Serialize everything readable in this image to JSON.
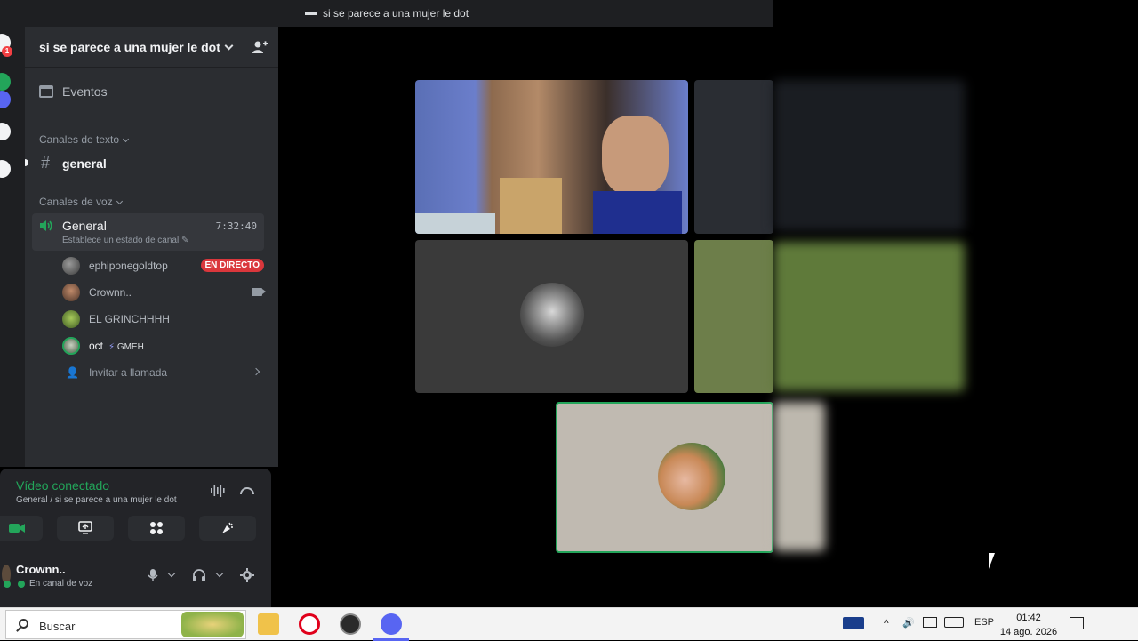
{
  "window": {
    "title": "si se parece a una mujer le dot"
  },
  "server_rail": {
    "badge": "1"
  },
  "sidebar": {
    "guild_name": "si se parece a una mujer le dot",
    "events_label": "Eventos",
    "text_category": "Canales de texto",
    "text_channel": "general",
    "voice_category": "Canales de voz",
    "voice_channel": {
      "name": "General",
      "elapsed": "7:32:40",
      "status_prompt": "Establece un estado de canal"
    },
    "members": [
      {
        "name": "ephiponegoldtop",
        "badge": "EN DIRECTO"
      },
      {
        "name": "Crownn.."
      },
      {
        "name": "EL GRINCHHHH"
      },
      {
        "name": "oct",
        "tag": "GMEH"
      }
    ],
    "invite_label": "Invitar a llamada"
  },
  "voice_panel": {
    "title": "Vídeo conectado",
    "subtitle": "General / si se parece a una mujer le dot"
  },
  "user": {
    "name": "Crownn..",
    "status": "En canal de voz"
  },
  "taskbar": {
    "search_placeholder": "Buscar",
    "language": "ESP",
    "time": "01:42",
    "date": "14 ago. 2026"
  },
  "colors": {
    "accent_green": "#23a55a",
    "live_red": "#da373c",
    "sidebar_bg": "#2b2d31",
    "rail_bg": "#1e1f22"
  }
}
